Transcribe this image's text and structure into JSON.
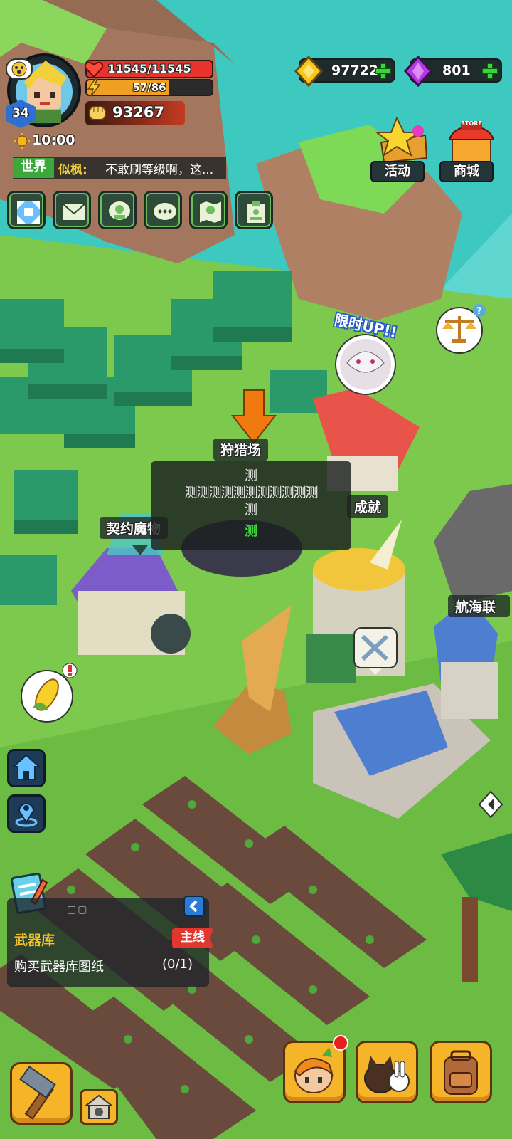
{
  "player": {
    "level": "34",
    "hp": "11545/11545",
    "hp_pct": 1.0,
    "energy": "57/86",
    "energy_pct": 0.66,
    "power": "93267",
    "time": "10:00"
  },
  "currencies": {
    "gold": "97722",
    "gems": "801"
  },
  "chat": {
    "channel": "世界",
    "sender": "似枫:",
    "message": "不敢刷等级啊，这..."
  },
  "top_right": {
    "events_label": "活动",
    "store_label": "商城",
    "store_sign": "STORE"
  },
  "quick_icons": [
    "expand-icon",
    "mail-icon",
    "friends-icon",
    "chat-bubbles-icon",
    "map-icon",
    "id-card-icon"
  ],
  "map_labels": {
    "hunting": "狩猎场",
    "contract": "契约魔物",
    "achievement": "成就",
    "navigation": "航海联",
    "limited_up": "限时UP!!"
  },
  "tooltip": {
    "line1": "测",
    "line2": "测测测测测测测测测测测",
    "line3": "测",
    "line4": "测"
  },
  "quest": {
    "title": "武器库",
    "tag": "主线",
    "description": "购买武器库图纸",
    "progress": "(0/1)",
    "dots": "▢▢"
  },
  "colors": {
    "hp_bar": "#e8322b",
    "energy_bar": "#f0a020",
    "quest_title": "#f3c12a",
    "quest_tag": "#e2362e",
    "chat_channel": "#3aa83a",
    "sender": "#f0d040",
    "grass": "#7cc94e",
    "water": "#3ec9c0"
  }
}
